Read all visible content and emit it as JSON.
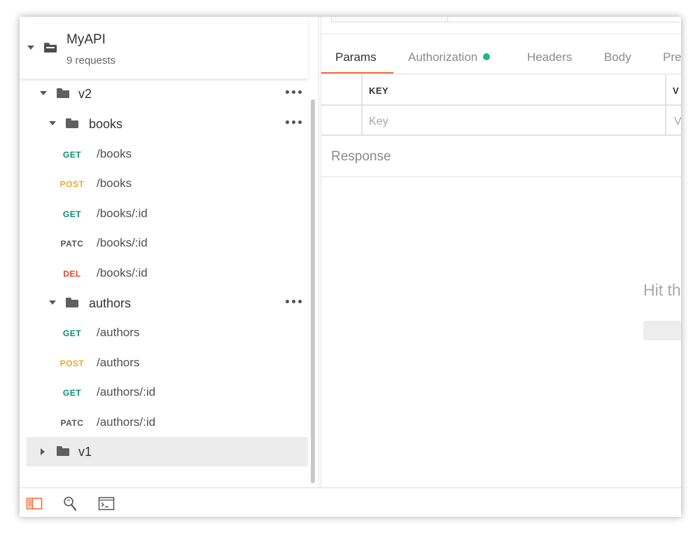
{
  "collection": {
    "name": "MyAPI",
    "count_label": "9 requests"
  },
  "tree": {
    "v2": {
      "name": "v2"
    },
    "books": {
      "name": "books",
      "requests": [
        {
          "method": "GET",
          "path": "/books"
        },
        {
          "method": "POST",
          "path": "/books"
        },
        {
          "method": "GET",
          "path": "/books/:id"
        },
        {
          "method": "PATC",
          "path": "/books/:id"
        },
        {
          "method": "DEL",
          "path": "/books/:id"
        }
      ]
    },
    "authors": {
      "name": "authors",
      "requests": [
        {
          "method": "GET",
          "path": "/authors"
        },
        {
          "method": "POST",
          "path": "/authors"
        },
        {
          "method": "GET",
          "path": "/authors/:id"
        },
        {
          "method": "PATC",
          "path": "/authors/:id"
        }
      ]
    },
    "v1": {
      "name": "v1"
    }
  },
  "method_colors": {
    "GET": "#0f8f6a",
    "POST": "#f5a623",
    "PATC": "#555555",
    "DEL": "#e8412c"
  },
  "tabs": {
    "params": "Params",
    "authorization": "Authorization",
    "headers": "Headers",
    "body": "Body",
    "pre": "Pre"
  },
  "params_table": {
    "key_header": "KEY",
    "value_header": "V",
    "key_placeholder": "Key",
    "value_placeholder": "V"
  },
  "response": {
    "label": "Response",
    "hint": "Hit th"
  },
  "colors": {
    "accent": "#f26b3a",
    "auth_dot": "#26b47f"
  }
}
